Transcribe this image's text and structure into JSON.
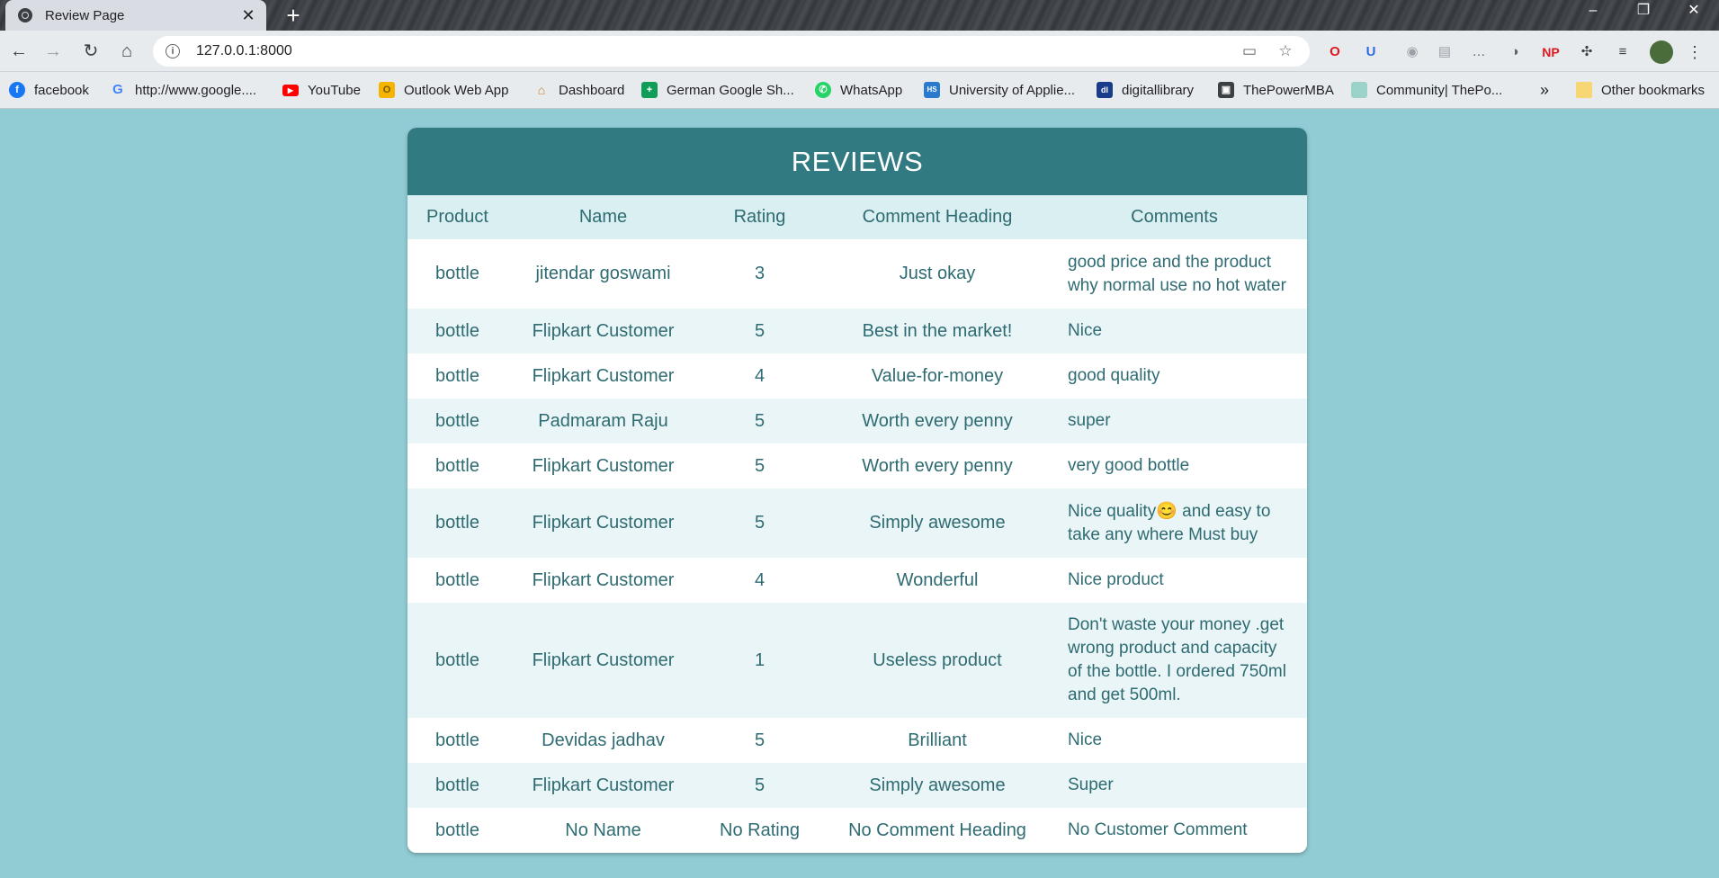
{
  "browser": {
    "tab_title": "Review Page",
    "tab_close": "✕",
    "new_tab": "+",
    "url": "127.0.0.1:8000",
    "window_minimize": "–",
    "window_restore": "❐",
    "window_close": "✕",
    "nav": {
      "back": "←",
      "forward": "→",
      "reload": "↻",
      "home": "⌂"
    },
    "bookmarks": [
      {
        "label": "facebook",
        "icon": "facebook-icon",
        "color": "#1877f2"
      },
      {
        "label": "http://www.google....",
        "icon": "google-icon",
        "color": "#ffffff"
      },
      {
        "label": "YouTube",
        "icon": "youtube-icon",
        "color": "#ff0000"
      },
      {
        "label": "Outlook Web App",
        "icon": "outlook-icon",
        "color": "#f4b400"
      },
      {
        "label": "Dashboard",
        "icon": "dashboard-icon",
        "color": "#c97b2a"
      },
      {
        "label": "German Google Sh...",
        "icon": "sheets-icon",
        "color": "#0f9d58"
      },
      {
        "label": "WhatsApp",
        "icon": "whatsapp-icon",
        "color": "#25d366"
      },
      {
        "label": "University of Applie...",
        "icon": "university-icon",
        "color": "#2a7bd0"
      },
      {
        "label": "digitallibrary",
        "icon": "library-icon",
        "color": "#1a3c8c"
      },
      {
        "label": "ThePowerMBA",
        "icon": "powermba-icon",
        "color": "#3c4043"
      },
      {
        "label": "Community| ThePo...",
        "icon": "community-icon",
        "color": "#9bd3c8"
      }
    ],
    "more_bookmarks": "»",
    "other_bookmarks": "Other bookmarks"
  },
  "reviews": {
    "title": "REVIEWS",
    "columns": [
      "Product",
      "Name",
      "Rating",
      "Comment Heading",
      "Comments"
    ],
    "rows": [
      {
        "product": "bottle",
        "name": "jitendar goswami",
        "rating": "3",
        "heading": "Just okay",
        "comment": "good price and the product why normal use no hot water"
      },
      {
        "product": "bottle",
        "name": "Flipkart Customer",
        "rating": "5",
        "heading": "Best in the market!",
        "comment": "Nice"
      },
      {
        "product": "bottle",
        "name": "Flipkart Customer",
        "rating": "4",
        "heading": "Value-for-money",
        "comment": "good quality"
      },
      {
        "product": "bottle",
        "name": "Padmaram Raju",
        "rating": "5",
        "heading": "Worth every penny",
        "comment": "super"
      },
      {
        "product": "bottle",
        "name": "Flipkart Customer",
        "rating": "5",
        "heading": "Worth every penny",
        "comment": "very good bottle"
      },
      {
        "product": "bottle",
        "name": "Flipkart Customer",
        "rating": "5",
        "heading": "Simply awesome",
        "comment": "Nice quality😊 and easy to take any where Must buy"
      },
      {
        "product": "bottle",
        "name": "Flipkart Customer",
        "rating": "4",
        "heading": "Wonderful",
        "comment": "Nice product"
      },
      {
        "product": "bottle",
        "name": "Flipkart Customer",
        "rating": "1",
        "heading": "Useless product",
        "comment": "Don't waste your money .get wrong product and capacity of the bottle. I ordered 750ml and get 500ml."
      },
      {
        "product": "bottle",
        "name": "Devidas jadhav",
        "rating": "5",
        "heading": "Brilliant",
        "comment": "Nice"
      },
      {
        "product": "bottle",
        "name": "Flipkart Customer",
        "rating": "5",
        "heading": "Simply awesome",
        "comment": "Super"
      },
      {
        "product": "bottle",
        "name": "No Name",
        "rating": "No Rating",
        "heading": "No Comment Heading",
        "comment": "No Customer Comment"
      }
    ]
  }
}
